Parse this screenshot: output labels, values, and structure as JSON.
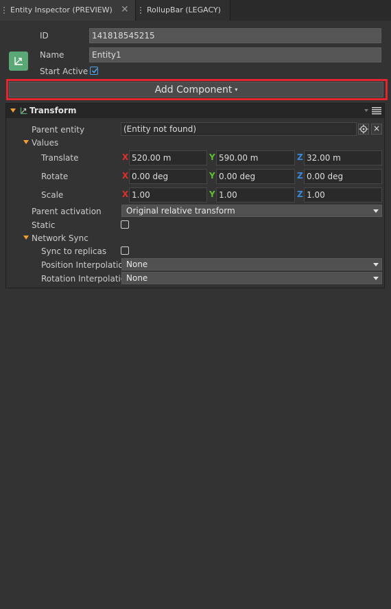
{
  "tabs": [
    {
      "label": "Entity Inspector (PREVIEW)",
      "close": "✕"
    },
    {
      "label": "RollupBar (LEGACY)"
    }
  ],
  "entity": {
    "id_label": "ID",
    "id_value": "141818545215",
    "name_label": "Name",
    "name_value": "Entity1",
    "start_active_label": "Start Active",
    "start_active_checked": true
  },
  "add_component": {
    "label": "Add Component",
    "caret": "▾"
  },
  "transform": {
    "title": "Transform",
    "parent_entity_label": "Parent entity",
    "parent_entity_value": "(Entity not found)",
    "parent_entity_clear": "×",
    "values_label": "Values",
    "axis_labels": {
      "x": "X",
      "y": "Y",
      "z": "Z"
    },
    "translate": {
      "label": "Translate",
      "x": "520.00 m",
      "y": "590.00 m",
      "z": "32.00 m"
    },
    "rotate": {
      "label": "Rotate",
      "x": "0.00 deg",
      "y": "0.00 deg",
      "z": "0.00 deg"
    },
    "scale": {
      "label": "Scale",
      "x": "1.00",
      "y": "1.00",
      "z": "1.00"
    },
    "parent_activation_label": "Parent activation",
    "parent_activation_value": "Original relative transform",
    "static_label": "Static",
    "static_checked": false,
    "network_sync_label": "Network Sync",
    "sync_replicas_label": "Sync to replicas",
    "sync_replicas_checked": false,
    "position_interp_label": "Position Interpolation",
    "position_interp_value": "None",
    "rotation_interp_label": "Rotation Interpolation",
    "rotation_interp_value": "None"
  },
  "colors": {
    "highlight_outline": "#e5252d",
    "accent_orange": "#f0a030",
    "axis_x": "#e0302a",
    "axis_y": "#60c030",
    "axis_z": "#3a8ae0",
    "entity_icon_bg": "#5aa875"
  },
  "icons": [
    "transform-icon",
    "close-icon",
    "grip-icon",
    "target-icon",
    "checkmark-icon",
    "menu-icon",
    "caret-down-icon"
  ]
}
